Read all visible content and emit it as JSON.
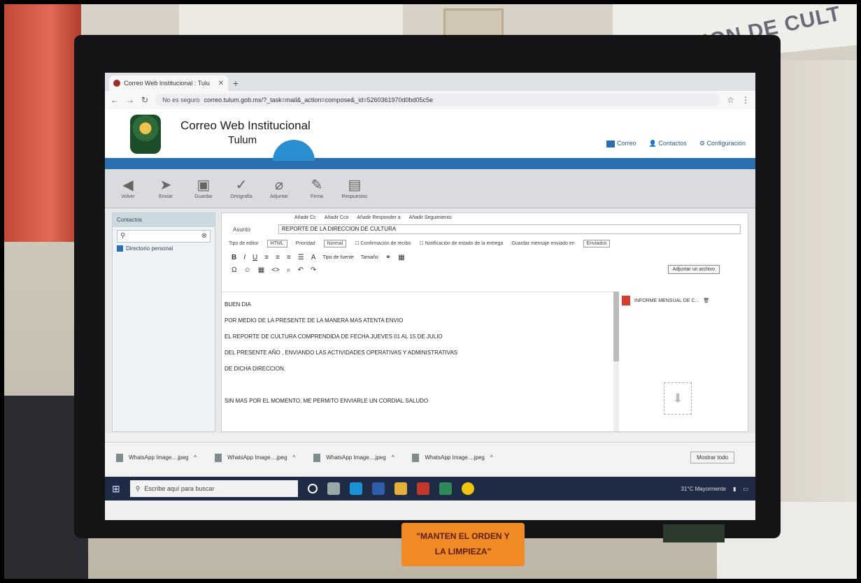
{
  "browser": {
    "tab_title": "Correo Web Institucional : Tulu",
    "url_warning": "No es seguro",
    "url": "correo.tulum.gob.mx/?_task=mail&_action=compose&_id=5260361970d0bd05c5e"
  },
  "app": {
    "title": "Correo Web Institucional",
    "subtitle": "Tulum",
    "nav": [
      "Correo",
      "Contactos",
      "Configuración"
    ]
  },
  "toolbar": [
    "Volver",
    "Enviar",
    "Guardar",
    "Ortografía",
    "Adjuntar",
    "Firma",
    "Respuestas"
  ],
  "sidebar": {
    "header": "Contactos",
    "search_icon": "search-icon",
    "item": "Directorio personal"
  },
  "compose": {
    "recipient_options": [
      "Añadir Cc",
      "Añadir Cco",
      "Añadir Responder a",
      "Añadir Seguimiento"
    ],
    "subject_label": "Asunto",
    "subject_value": "REPORTE DE LA DIRECCION DE CULTURA",
    "editor_type_label": "Tipo de editor",
    "editor_type_value": "HTML",
    "priority_label": "Prioridad",
    "priority_value": "Normal",
    "receipt_label": "Confirmación de recibo",
    "delivery_label": "Notificación de estado de la entrega",
    "save_sent_label": "Guardar mensaje enviado en",
    "save_sent_value": "Enviados",
    "font_label": "Tipo de fuente",
    "size_label": "Tamaño",
    "attach_button": "Adjuntar un archivo",
    "body_lines": [
      "BUEN DIA",
      "POR MEDIO DE LA PRESENTE DE LA MANERA MAS ATENTA ENVIO",
      "EL REPORTE DE CULTURA COMPRENDIDA DE FECHA JUEVES 01 AL 15 DE JULIO",
      "DEL PRESENTE AÑO , ENVIANDO LAS ACTIVIDADES OPERATIVAS Y ADMINISTRATIVAS",
      "DE DICHA DIRECCION.",
      "",
      "SIN MAS POR EL MOMENTO, ME PERMITO ENVIARLE UN CORDIAL SALUDO"
    ],
    "attachment_name": "INFORME MENSUAL DE C..."
  },
  "downloads": {
    "items": [
      "WhatsApp Image....jpeg",
      "WhatsApp Image....jpeg",
      "WhatsApp Image....jpeg",
      "WhatsApp Image....jpeg"
    ],
    "show_all": "Mostrar todo"
  },
  "taskbar": {
    "search_placeholder": "Escribe aquí para buscar",
    "weather": "31°C Mayormente"
  },
  "sign": {
    "line1": "\"MANTEN EL ORDEN Y",
    "line2": "LA LIMPIEZA\""
  },
  "banner_text": "DIRECCION DE CULT"
}
